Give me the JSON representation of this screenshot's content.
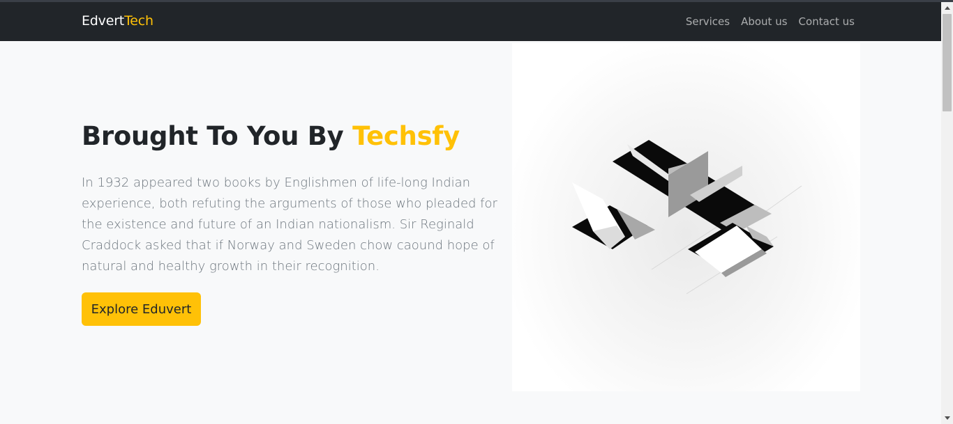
{
  "navbar": {
    "brand_primary": "Edvert",
    "brand_accent": "Tech",
    "links": [
      "Services",
      "About us",
      "Contact us"
    ]
  },
  "hero": {
    "title_main": "Brought To You By ",
    "title_accent": "Techsfy",
    "description": "In 1932 appeared two books by Englishmen of life-long Indian experience, both refuting the arguments of those who pleaded for the existence and future of an Indian nationalism. Sir Reginald Craddock asked that if Norway and Sweden chow caound hope of natural and healthy growth in their recognition.",
    "cta_label": "Explore Eduvert"
  },
  "colors": {
    "navbar_bg": "#212529",
    "accent": "#ffc107",
    "page_bg": "#f8f9fa",
    "text_muted": "#6c757d"
  }
}
